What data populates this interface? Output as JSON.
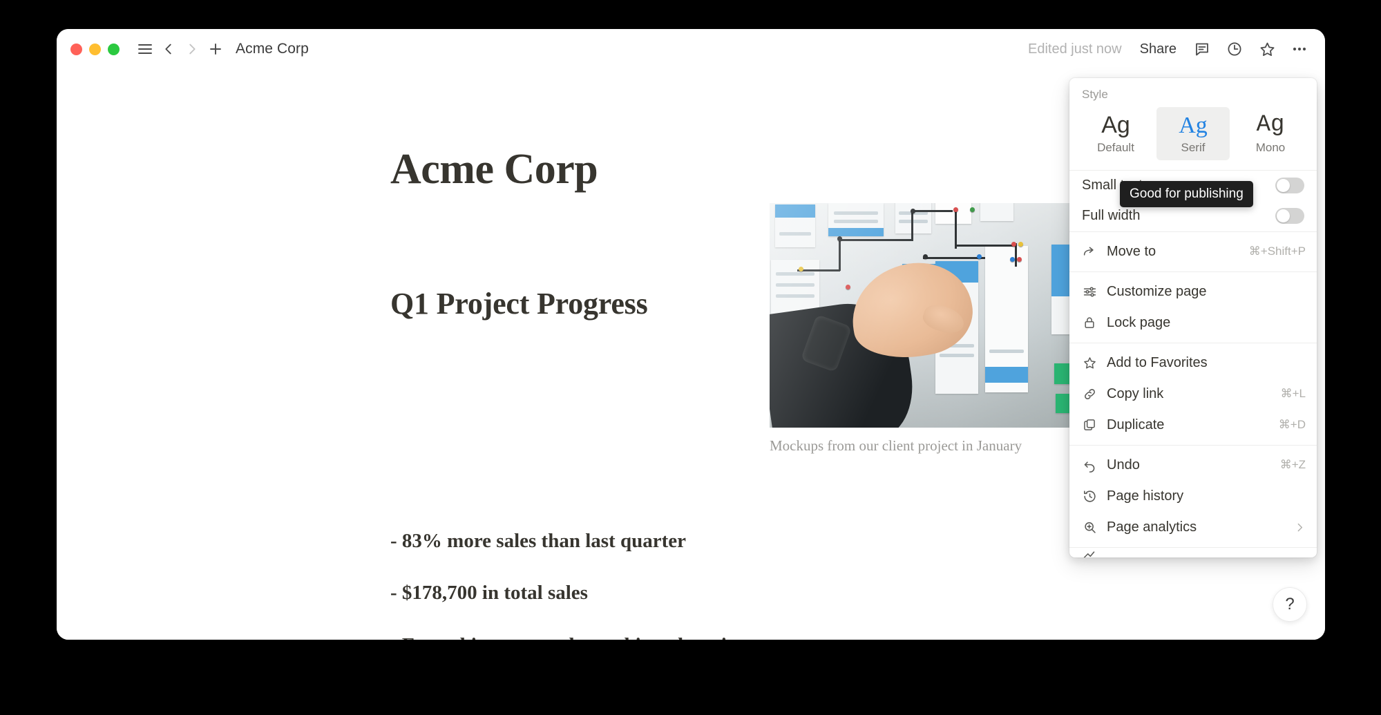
{
  "window": {
    "titlebar": {
      "traffic_lights": [
        "close",
        "minimize",
        "maximize"
      ],
      "menu_icon": "hamburger-icon",
      "back_icon": "chevron-left-icon",
      "forward_icon": "chevron-right-icon",
      "new_page_icon": "plus-icon",
      "page_title": "Acme Corp",
      "edited_label": "Edited just now",
      "share_label": "Share",
      "right_icons": [
        "comment-icon",
        "clock-icon",
        "star-icon",
        "more-options-icon"
      ]
    }
  },
  "document": {
    "title": "Acme Corp",
    "heading": "Q1 Project Progress",
    "bullets": [
      "- 83% more sales than last quarter",
      "- $178,700 in total sales",
      "- Everything, everywhere, shipped on time"
    ],
    "image_caption": "Mockups from our client project in January"
  },
  "help_button": {
    "label": "?"
  },
  "menu": {
    "style": {
      "section_label": "Style",
      "options": [
        {
          "glyph": "Ag",
          "label": "Default",
          "selected": false
        },
        {
          "glyph": "Ag",
          "label": "Serif",
          "selected": true
        },
        {
          "glyph": "Ag",
          "label": "Mono",
          "selected": false
        }
      ]
    },
    "toggles": [
      {
        "label": "Small text",
        "on": false
      },
      {
        "label": "Full width",
        "on": false
      }
    ],
    "groups": [
      {
        "items": [
          {
            "icon": "move-to-arrow-icon",
            "label": "Move to",
            "shortcut": "⌘+Shift+P"
          }
        ]
      },
      {
        "items": [
          {
            "icon": "sliders-icon",
            "label": "Customize page",
            "shortcut": ""
          },
          {
            "icon": "lock-icon",
            "label": "Lock page",
            "shortcut": ""
          }
        ]
      },
      {
        "items": [
          {
            "icon": "star-icon",
            "label": "Add to Favorites",
            "shortcut": ""
          },
          {
            "icon": "link-icon",
            "label": "Copy link",
            "shortcut": "⌘+L"
          },
          {
            "icon": "duplicate-icon",
            "label": "Duplicate",
            "shortcut": "⌘+D"
          }
        ]
      },
      {
        "items": [
          {
            "icon": "undo-icon",
            "label": "Undo",
            "shortcut": "⌘+Z"
          },
          {
            "icon": "history-clock-icon",
            "label": "Page history",
            "shortcut": ""
          },
          {
            "icon": "analytics-magnifier-icon",
            "label": "Page analytics",
            "shortcut": "",
            "submenu": true
          }
        ]
      }
    ]
  },
  "tooltip": {
    "text": "Good for publishing"
  },
  "colors": {
    "accent_blue": "#2383e2",
    "text_primary": "#37352f",
    "text_muted": "#9b9a97",
    "selected_bg": "#efefee",
    "tooltip_bg": "#1f1f1f",
    "traffic_red": "#ff6158",
    "traffic_yellow": "#ffbe30",
    "traffic_green": "#2bc940"
  }
}
